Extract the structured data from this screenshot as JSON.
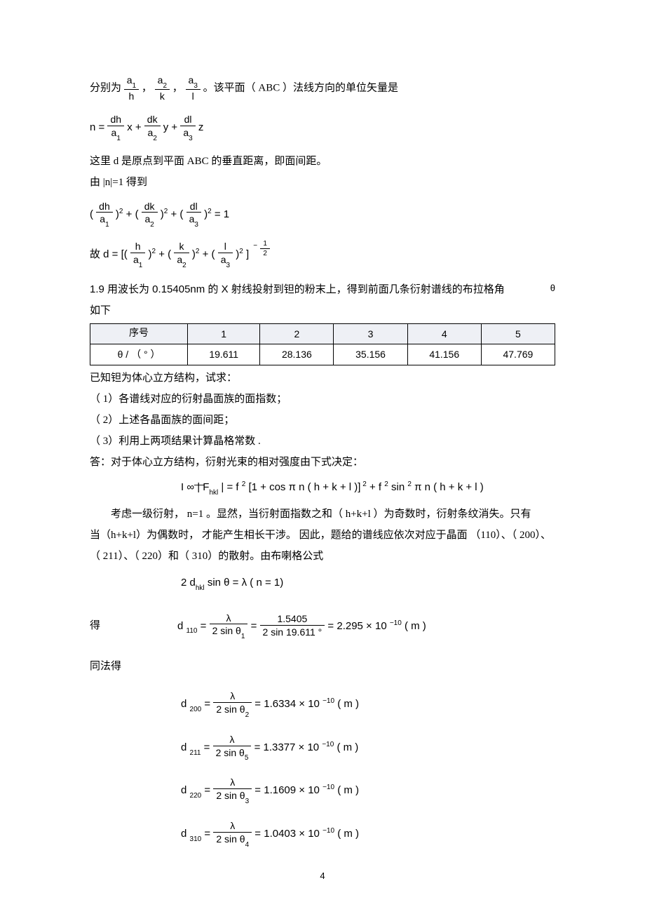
{
  "p1_pre": "分别为 ",
  "p1_mid1": "，",
  "p1_mid2": "，",
  "p1_post": " 。该平面（ ABC ）法线方向的单位矢量是",
  "frac_a1": "a",
  "frac_a1_sub": "1",
  "frac_h": "h",
  "frac_a2": "a",
  "frac_a2_sub": "2",
  "frac_k": "k",
  "frac_a3": "a",
  "frac_a3_sub": "3",
  "frac_l": "l",
  "eq_n_lhs": "n  = ",
  "eq_n_t1n": "dh",
  "eq_n_t1d": "a",
  "eq_n_t1s": "1",
  "eq_n_t1v": " x  + ",
  "eq_n_t2n": "dk",
  "eq_n_t2d": "a",
  "eq_n_t2s": "2",
  "eq_n_t2v": " y  + ",
  "eq_n_t3n": "dl",
  "eq_n_t3d": "a",
  "eq_n_t3s": "3",
  "eq_n_t3v": " z",
  "p2": "这里 d 是原点到平面    ABC  的垂直距离，即面间距。",
  "p3": "由 |n|=1 得到",
  "eq_sq_open": "(",
  "eq_sq_close": ")",
  "eq_sq_p2": "2",
  "eq_sq_plus": "  + ",
  "eq_sq_eq1": "  = 1",
  "p4_pre": "故  d  = [( ",
  "p4_plus": "  + (",
  "p4_close": "]",
  "p4_exp": "2",
  "p4_negexp_n": "1",
  "p4_negexp_d": "2",
  "p4_neg": "−",
  "p5a": "1.9  用波长为    0.15405nm  的  X  射线投射到钽的粉末上，得到前面几条衍射谱线的布拉格角",
  "p5_theta": "θ",
  "p5b": "如下",
  "th_seq": "序号",
  "th_theta": "θ  /  （ °  ）",
  "cols": [
    "1",
    "2",
    "3",
    "4",
    "5"
  ],
  "vals": [
    "19.611",
    "28.136",
    "35.156",
    "41.156",
    "47.769"
  ],
  "p6": "已知钽为体心立方结构，试求：",
  "p6a": "（ 1）各谱线对应的衍射晶面族的面指数；",
  "p6b": "（ 2）上述各晶面族的面间距；",
  "p6c": "（ 3）利用上两项结果计算晶格常数      .",
  "p7": "答：对于体心立方结构，衍射光束的相对强度由下式决定：",
  "eq_I": "I ∞ | F",
  "eq_I_hkl": "hkl",
  "eq_I_rest1": " |  =  f ",
  "eq_I_p2a": "2",
  "eq_I_rest2": "[1  + cos  π n ( h  + k  + l )]",
  "eq_I_p2b": " 2",
  "eq_I_rest3": "  +  f ",
  "eq_I_p2c": "2",
  "eq_I_rest4": " sin ",
  "eq_I_p2d": "2",
  "eq_I_rest5": " π n ( h + k  + l )",
  "p8": "考虑一级衍射，    n=1 。显然，当衍射面指数之和（      h+k+l ）为奇数时，衍射条纹消失。只有",
  "p9": "当（h+k+l）为偶数时，  才能产生相长干涉。    因此，题给的谱线应依次对应于晶面      （110）、（ 200）、",
  "p10": "（ 211）、（ 220）和（ 310）的散射。由布喇格公式",
  "eq_bragg": "2 d",
  "eq_bragg_hkl": "hkl",
  "eq_bragg_rest": "  sin  θ  = λ ( n  = 1)",
  "got": "得",
  "d110_lhs": "d ",
  "d110_sub": "110",
  "d110_eq": "  = ",
  "lam": "λ",
  "two_sin": "2 sin  θ",
  "theta1": "1",
  "d110_num2": "1.5405",
  "d110_den2": "2 sin  19.611 °",
  "d110_val": " =  2.295   × 10 ",
  "d110_exp": "−10",
  "d110_unit": " ( m )",
  "p11": "同法得",
  "d200_sub": "200",
  "theta2": "2",
  "d200_val": " = 1.6334    × 10 ",
  "d200_exp": "−10",
  "unit_m": "( m )",
  "d211_sub": "211",
  "theta5": "5",
  "d211_val": " = 1.3377    × 10 ",
  "d211_exp": "−10",
  "d220_sub": "220",
  "theta3": "3",
  "d220_val": " = 1.1609    × 10 ",
  "d220_exp": "−10",
  "d310_sub": "310",
  "theta4": "4",
  "d310_val": " = 1.0403    × 10 ",
  "d310_exp": "−10",
  "pagenum": "4"
}
